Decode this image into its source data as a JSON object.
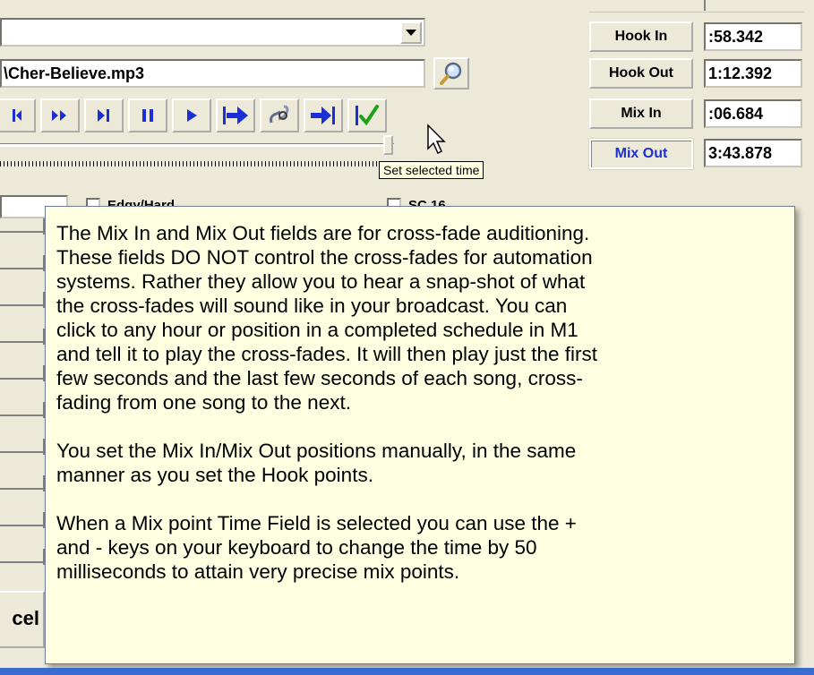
{
  "file": {
    "name": "\\Cher-Believe.mp3"
  },
  "icons": {
    "dropdown": "chevron-down-icon",
    "search": "magnifier-icon",
    "transport": [
      "rewind-icon",
      "fast-forward-icon",
      "skip-end-icon",
      "pause-icon",
      "play-icon",
      "jump-arrow-icon",
      "hook-link-icon",
      "jump-to-end-icon",
      "checkmark-icon"
    ]
  },
  "tooltip_small": {
    "text": "Set selected time"
  },
  "markers": [
    {
      "label": "Hook In",
      "value": ":58.342"
    },
    {
      "label": "Hook Out",
      "value": "1:12.392"
    },
    {
      "label": "Mix In",
      "value": ":06.684"
    },
    {
      "label": "Mix Out",
      "value": "3:43.878"
    }
  ],
  "checkboxes": [
    {
      "label": "Edgy/Hard"
    },
    {
      "label": "SC 16"
    }
  ],
  "cancel": {
    "label": "cel"
  },
  "help": {
    "paragraphs": [
      "The Mix In and Mix Out fields are for cross-fade auditioning.\nThese fields DO NOT control the cross-fades for automation\nsystems.  Rather they allow you to hear a snap-shot of what\nthe cross-fades will sound like in your broadcast.  You can\nclick to any hour or position in a completed schedule in M1\nand tell it to play the cross-fades.  It will then play just the first\nfew seconds and the last few seconds of each song, cross-\nfading from one song to the next.",
      "You set the Mix In/Mix Out positions manually, in the same\nmanner as you set the Hook points.",
      "When a Mix point Time Field is selected you can use the +\nand - keys on your keyboard to change the time by 50\nmilliseconds to attain very precise mix points."
    ]
  },
  "colors": {
    "accent_active": "#1a2fd4",
    "tooltip_bg": "#ffffe1",
    "check_green": "#1aa21a",
    "arrow_blue": "#1a2fd4"
  }
}
